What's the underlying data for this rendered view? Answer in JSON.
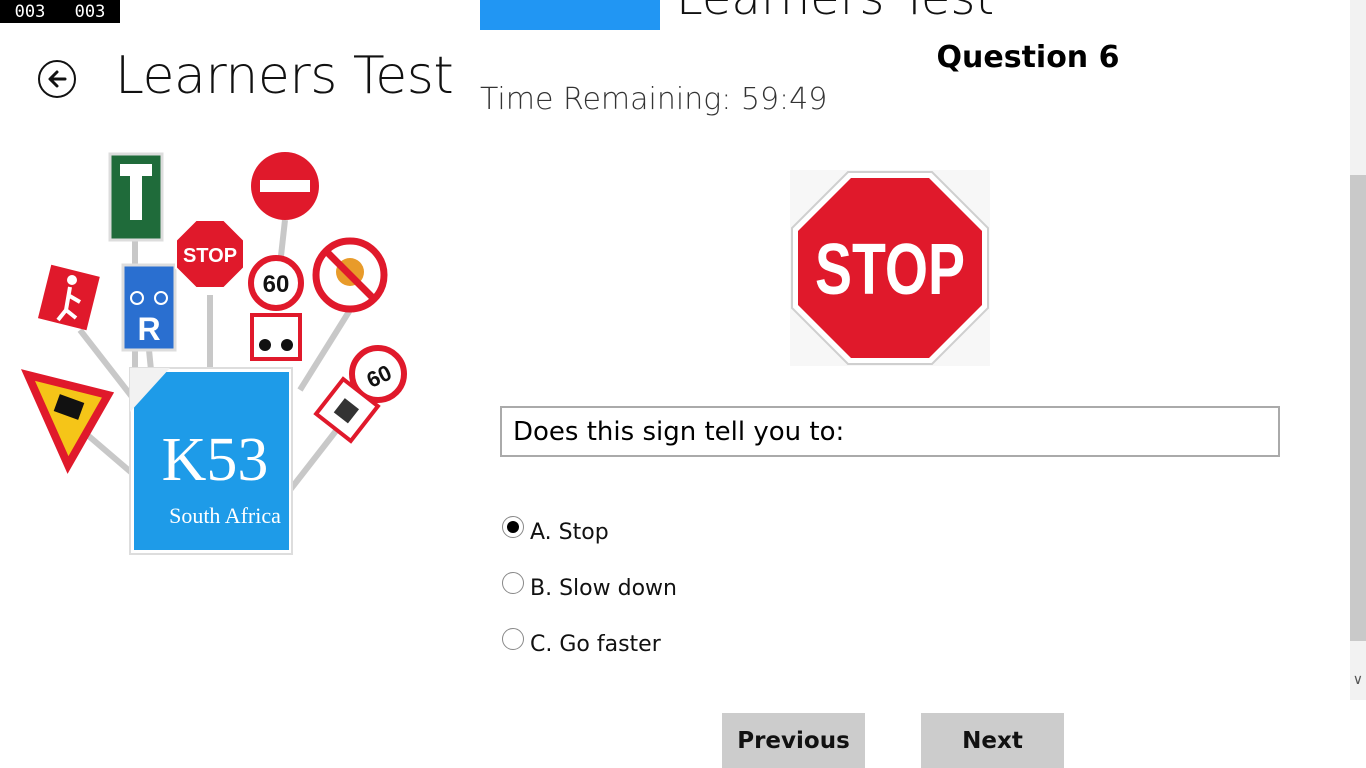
{
  "debug": {
    "left": "003",
    "right": "003"
  },
  "app": {
    "title": "Learners Test",
    "clipped_title": "Learners Test"
  },
  "question": {
    "heading": "Question 6",
    "timer_label": "Time Remaining:",
    "timer_value": "59:49",
    "sign_text": "STOP",
    "prompt": "Does this sign tell you to:"
  },
  "illustration": {
    "badge_main": "K53",
    "badge_sub": "South Africa"
  },
  "options": [
    {
      "label": "A. Stop",
      "selected": true
    },
    {
      "label": "B. Slow down",
      "selected": false
    },
    {
      "label": "C. Go faster",
      "selected": false
    }
  ],
  "nav": {
    "previous": "Previous",
    "next": "Next"
  },
  "colors": {
    "accent": "#2196f3",
    "stop_red": "#e0192b",
    "button_gray": "#cccccc"
  }
}
